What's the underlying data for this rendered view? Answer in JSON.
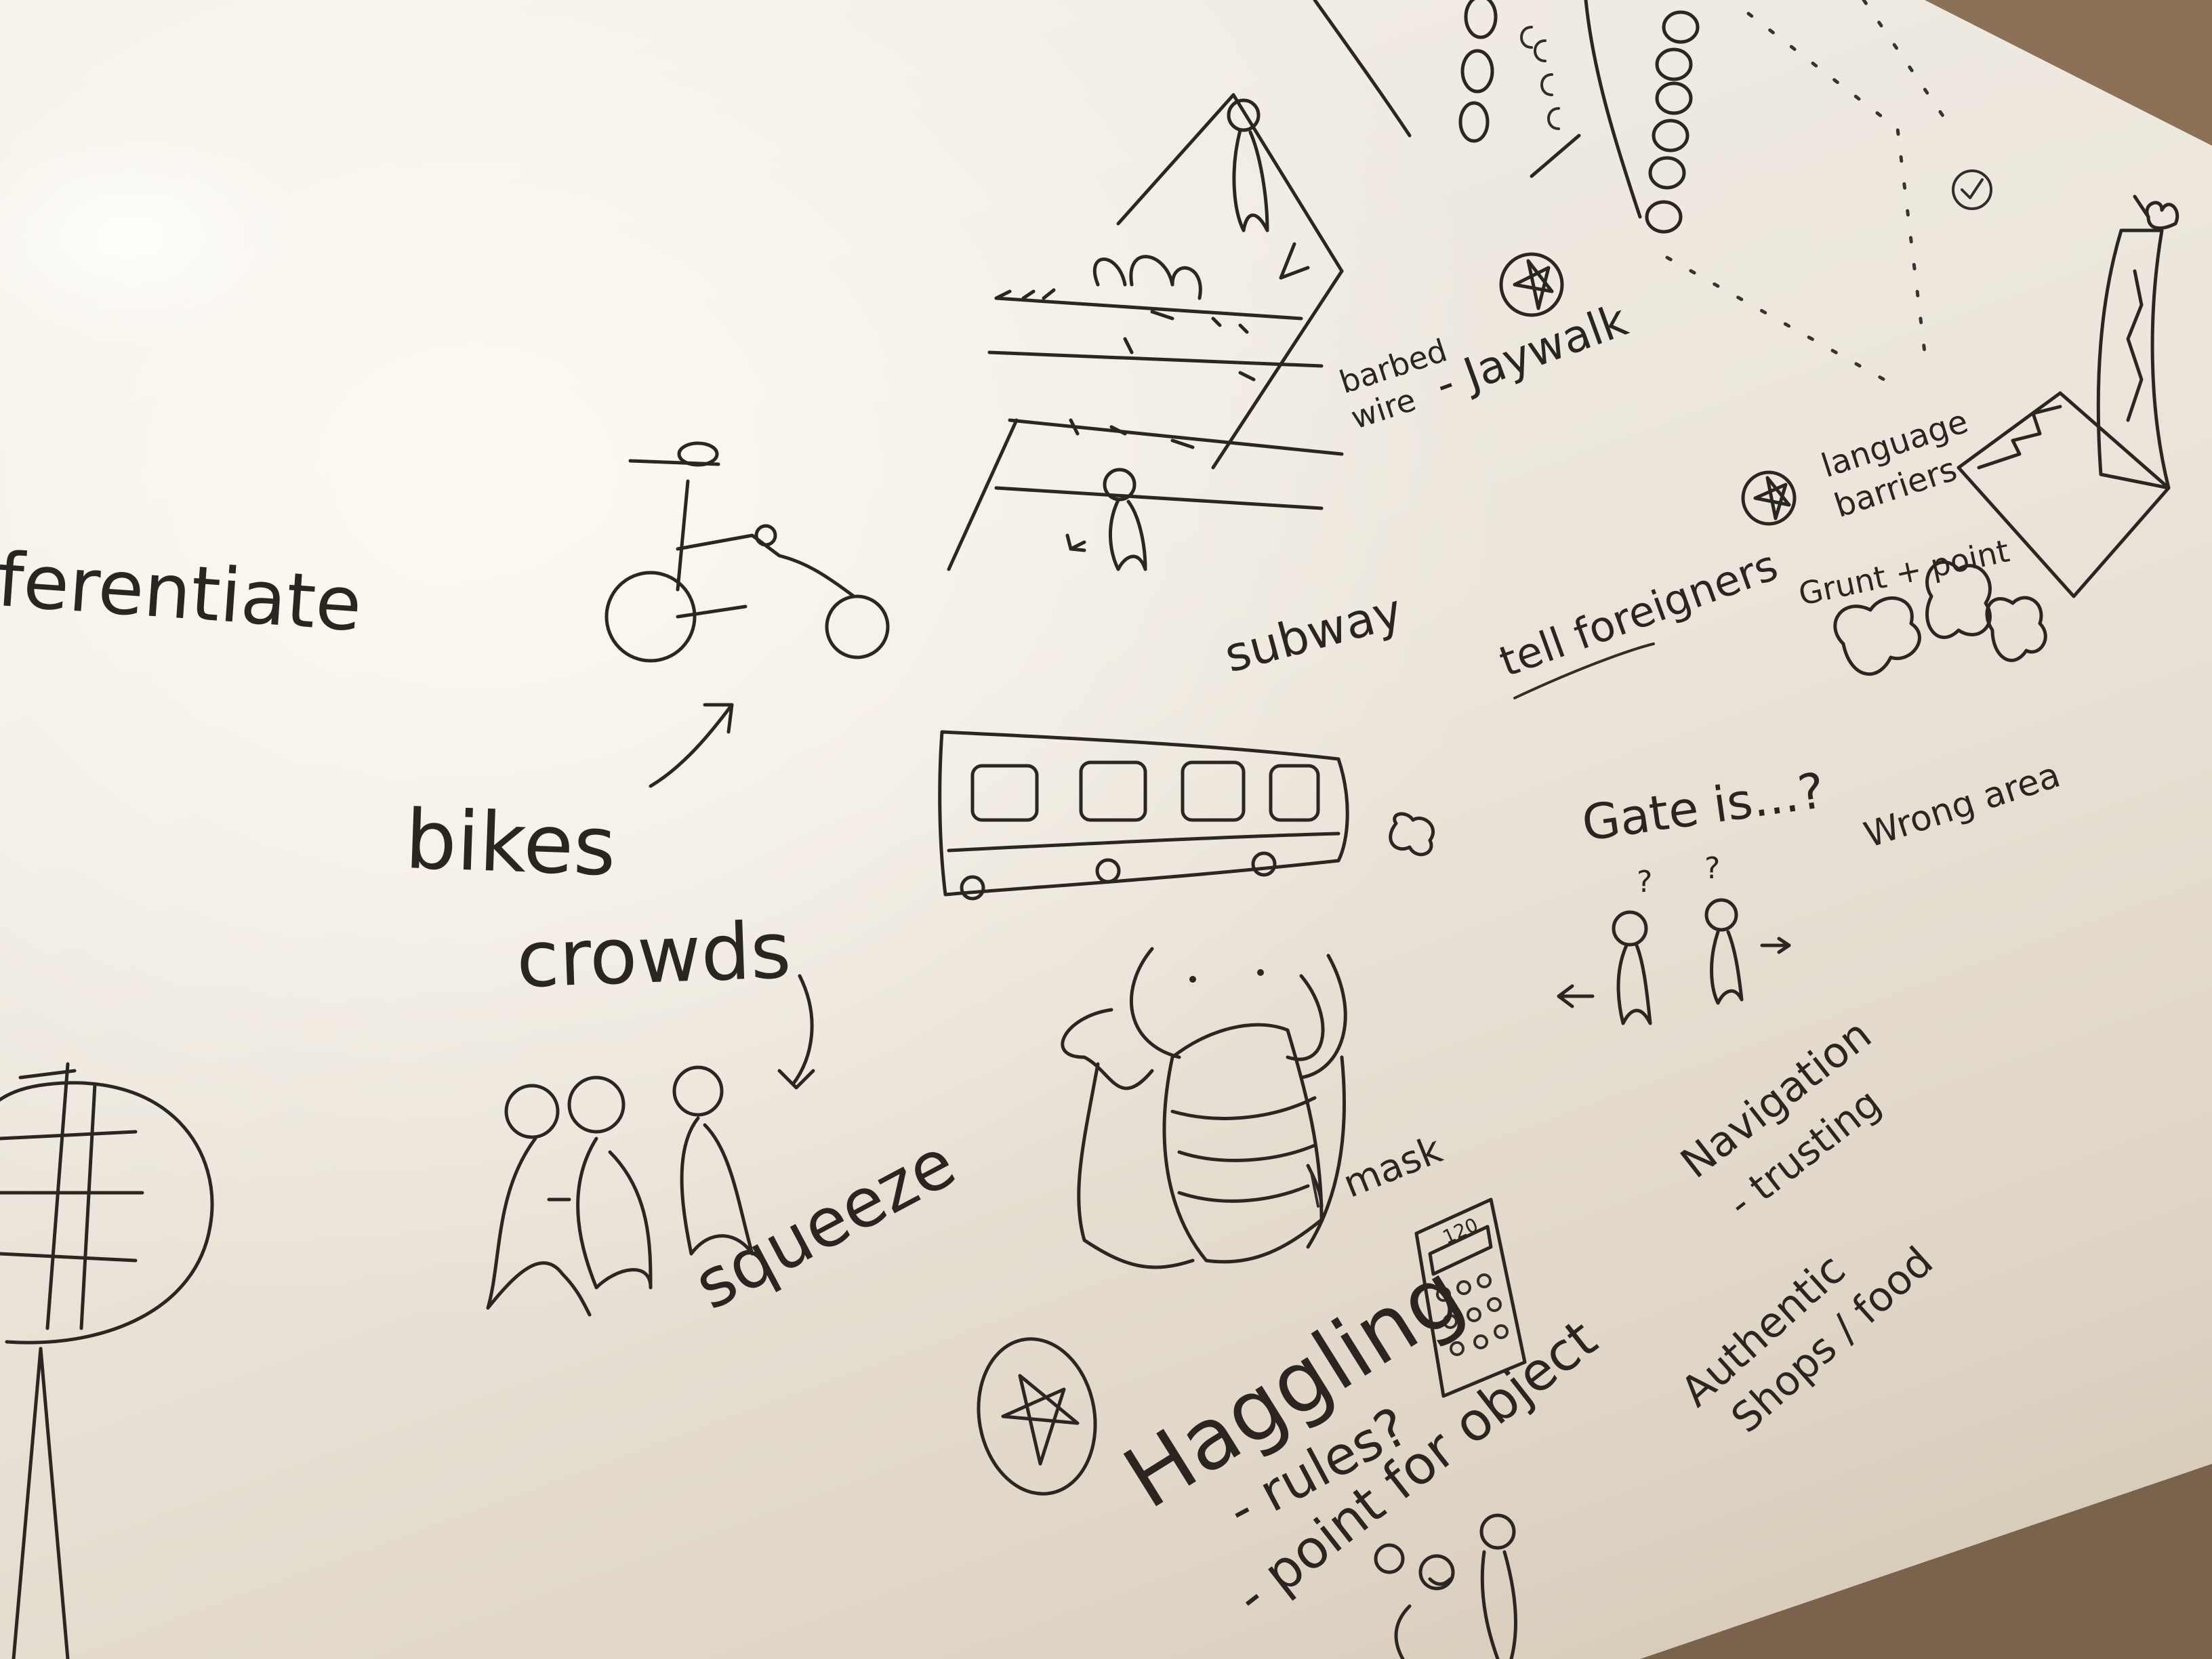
{
  "whiteboard": {
    "notes": {
      "differentiate": "ferentiate",
      "bikes": "bikes",
      "crowds": "crowds",
      "squeeze": "squeeze",
      "subway": "subway",
      "mask": "mask",
      "barbed_wire": "barbed wire",
      "jaywalk": "- Jaywalk",
      "tell_foreigners": "tell foreigners",
      "language_barriers": "language barriers",
      "grunt_point": "Grunt + point",
      "wrong_area": "Wrong area",
      "gate_is": "Gate is...?",
      "q1": "?",
      "q2": "?",
      "navigation": "Navigation",
      "trusting": "- trusting",
      "authentic": "Authentic",
      "shops_food": "Shops / food",
      "haggling": "Haggling",
      "rules": "- rules?",
      "point_object": "- point for object",
      "calculator_display": "120"
    }
  },
  "colors": {
    "ink": "#2b2622",
    "board": "#efe9e0",
    "frame": "#6f5540"
  }
}
